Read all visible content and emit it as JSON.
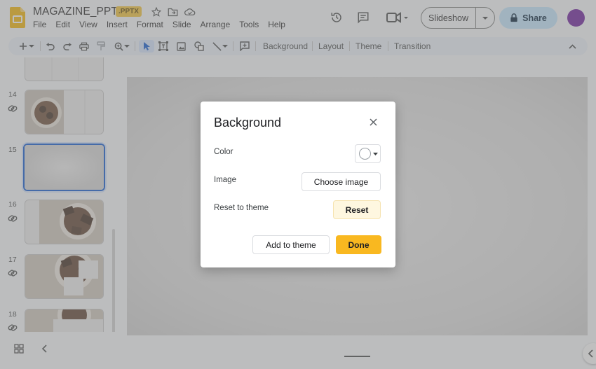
{
  "app": {
    "doc_title": "MAGAZINE_PPTX",
    "file_badge": ".PPTX",
    "brand_color": "#f4b400"
  },
  "menu": [
    "File",
    "Edit",
    "View",
    "Insert",
    "Format",
    "Slide",
    "Arrange",
    "Tools",
    "Help"
  ],
  "header": {
    "slideshow_label": "Slideshow",
    "share_label": "Share"
  },
  "toolbar": {
    "text_buttons": [
      "Background",
      "Layout",
      "Theme",
      "Transition"
    ]
  },
  "filmstrip": {
    "slides": [
      {
        "number": "14",
        "linked": true
      },
      {
        "number": "15",
        "linked": false,
        "selected": true
      },
      {
        "number": "16",
        "linked": true
      },
      {
        "number": "17",
        "linked": true
      },
      {
        "number": "18",
        "linked": true
      }
    ]
  },
  "dialog": {
    "title": "Background",
    "color_label": "Color",
    "image_label": "Image",
    "choose_image_label": "Choose image",
    "reset_theme_label": "Reset to theme",
    "reset_label": "Reset",
    "add_to_theme_label": "Add to theme",
    "done_label": "Done",
    "selected_color": "#ffffff"
  }
}
